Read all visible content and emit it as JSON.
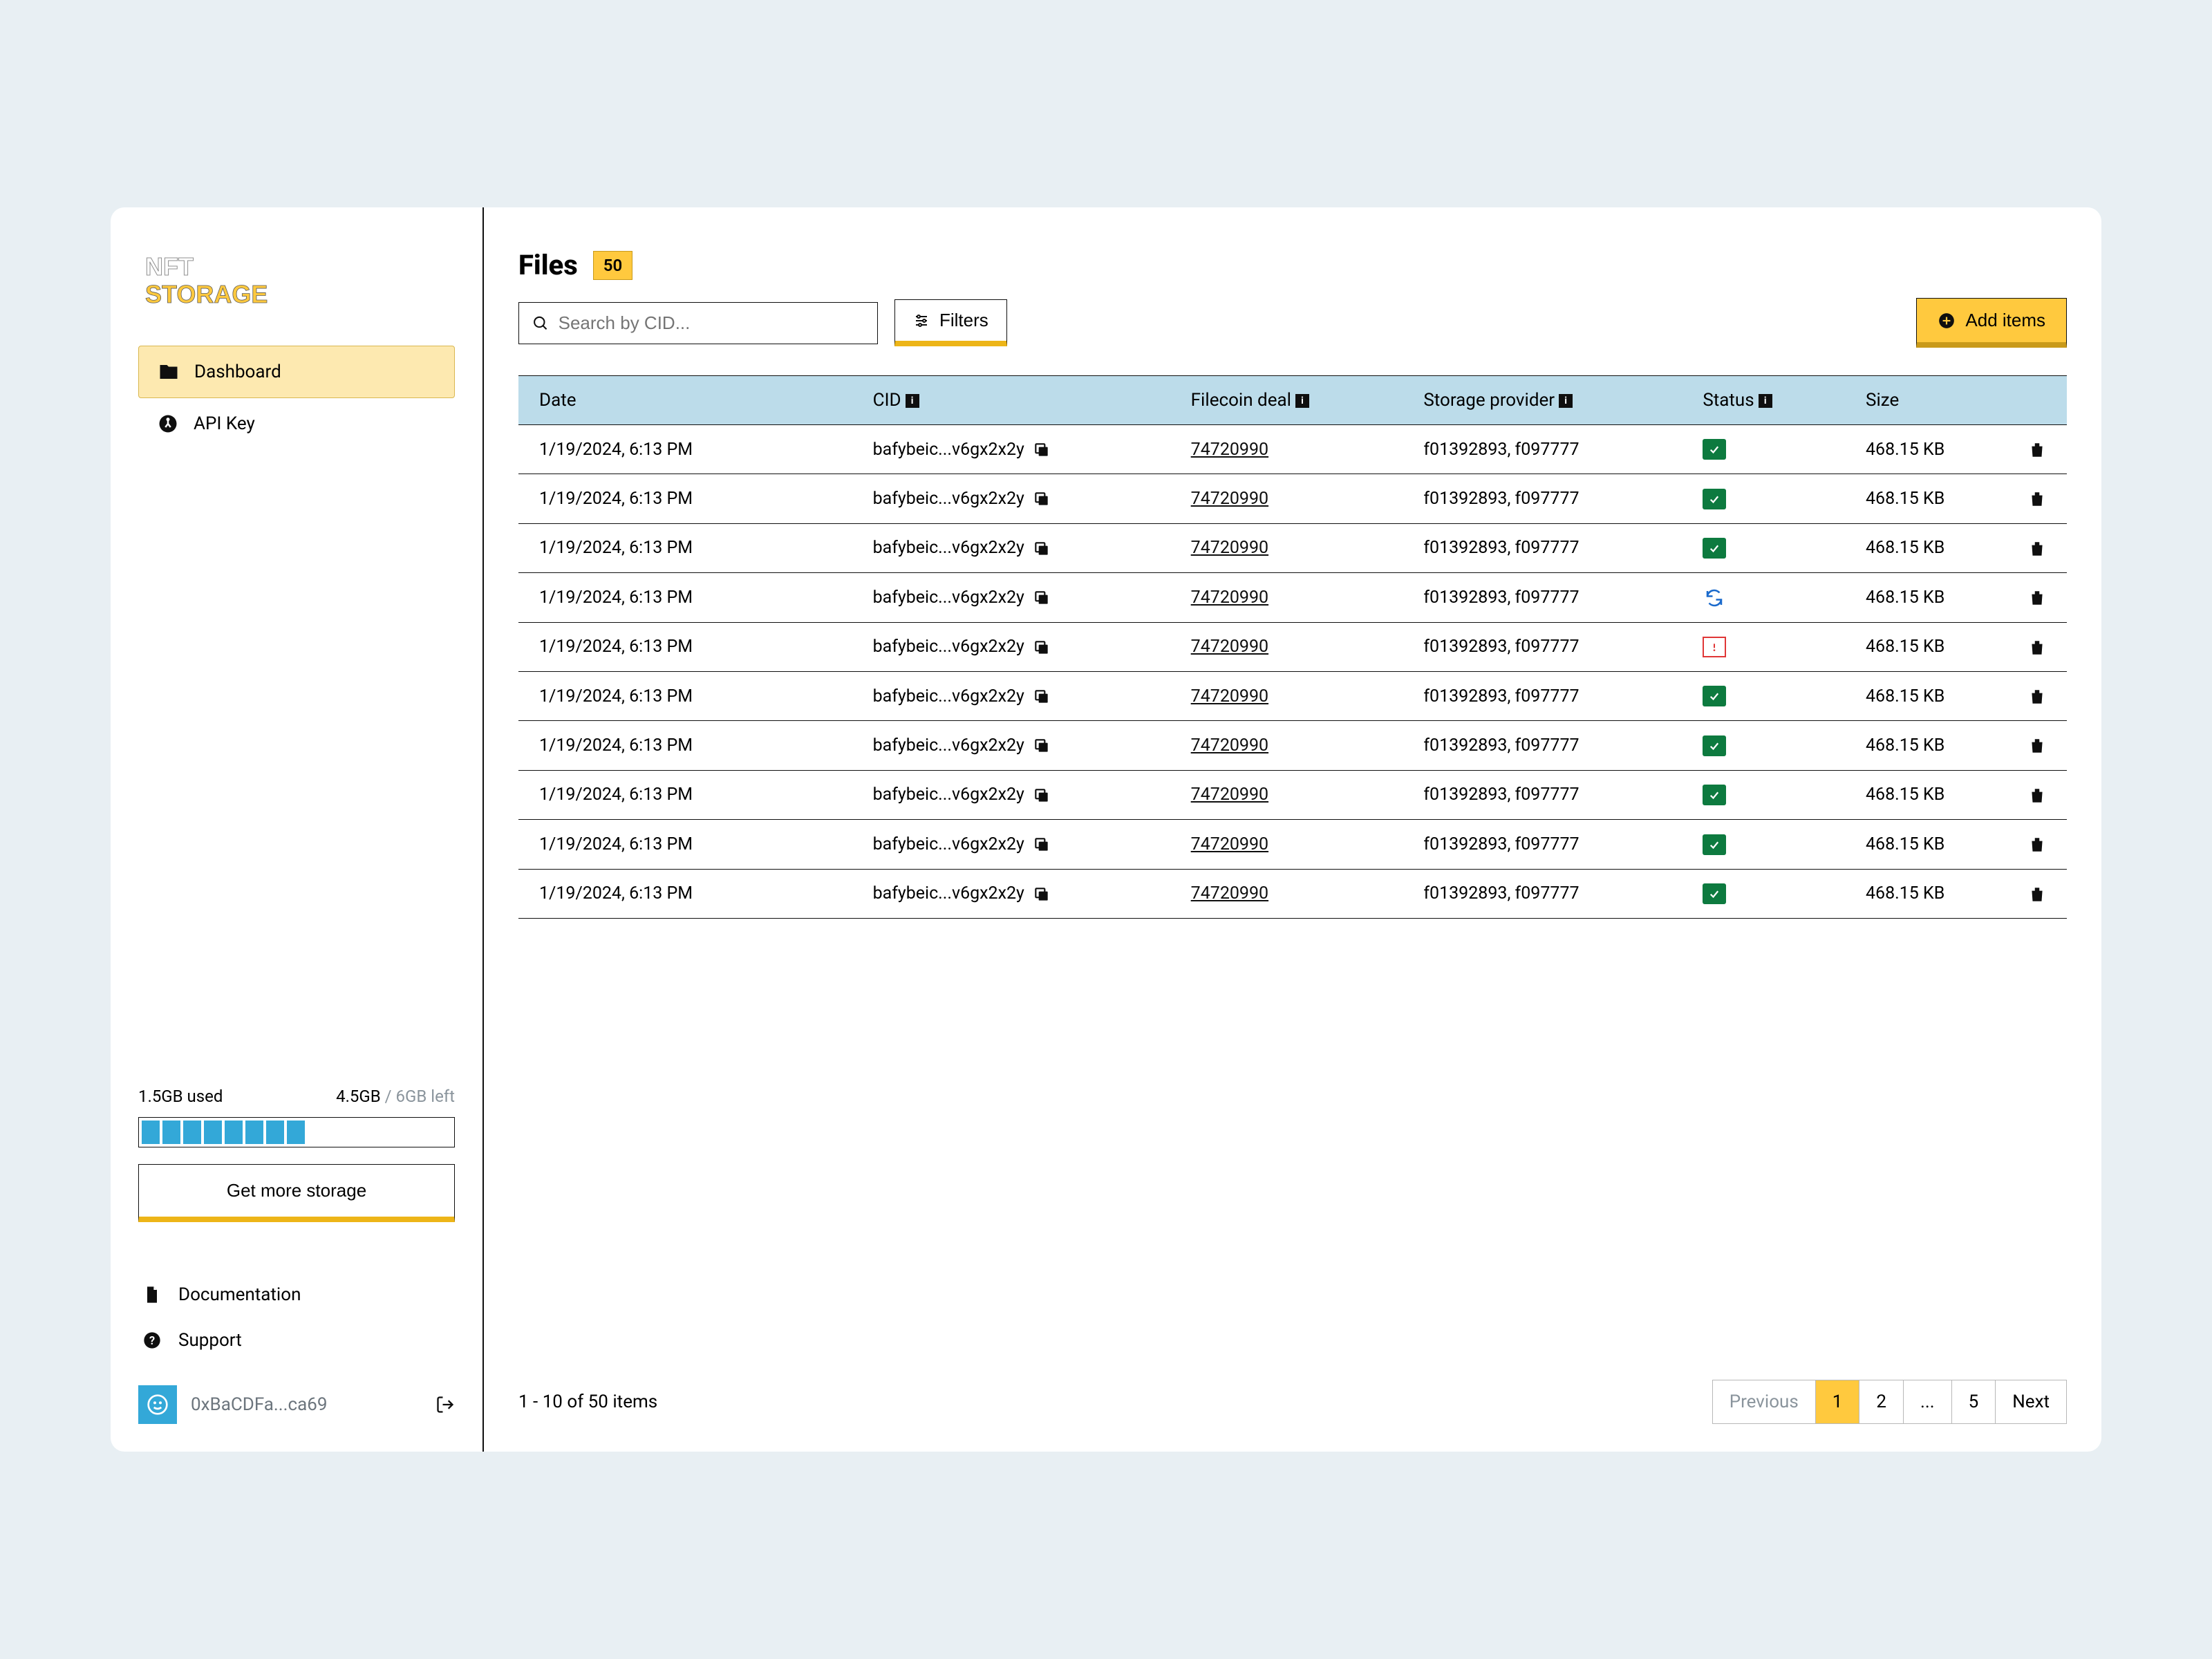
{
  "brand": "NFT STORAGE",
  "sidebar": {
    "items": [
      {
        "label": "Dashboard",
        "icon": "folder-icon",
        "active": true
      },
      {
        "label": "API Key",
        "icon": "key-icon",
        "active": false
      }
    ],
    "storage": {
      "used_label": "1.5GB used",
      "remaining_primary": "4.5GB",
      "remaining_muted": "/ 6GB left",
      "segments_filled": 8,
      "button_label": "Get more storage"
    },
    "footer_links": [
      {
        "label": "Documentation",
        "icon": "doc-icon"
      },
      {
        "label": "Support",
        "icon": "help-icon"
      }
    ],
    "user": {
      "address_short": "0xBaCDFa...ca69"
    }
  },
  "page": {
    "title": "Files",
    "count": "50"
  },
  "toolbar": {
    "search_placeholder": "Search by CID...",
    "filters_label": "Filters",
    "add_label": "Add items"
  },
  "columns": {
    "date": "Date",
    "cid": "CID",
    "deal": "Filecoin deal",
    "provider": "Storage provider",
    "status": "Status",
    "size": "Size"
  },
  "rows": [
    {
      "date": "1/19/2024, 6:13 PM",
      "cid": "bafybeic...v6gx2x2y",
      "deal": "74720990",
      "provider": "f01392893, f097777",
      "status": "ok",
      "size": "468.15 KB"
    },
    {
      "date": "1/19/2024, 6:13 PM",
      "cid": "bafybeic...v6gx2x2y",
      "deal": "74720990",
      "provider": "f01392893, f097777",
      "status": "ok",
      "size": "468.15 KB"
    },
    {
      "date": "1/19/2024, 6:13 PM",
      "cid": "bafybeic...v6gx2x2y",
      "deal": "74720990",
      "provider": "f01392893, f097777",
      "status": "ok",
      "size": "468.15 KB"
    },
    {
      "date": "1/19/2024, 6:13 PM",
      "cid": "bafybeic...v6gx2x2y",
      "deal": "74720990",
      "provider": "f01392893, f097777",
      "status": "sync",
      "size": "468.15 KB"
    },
    {
      "date": "1/19/2024, 6:13 PM",
      "cid": "bafybeic...v6gx2x2y",
      "deal": "74720990",
      "provider": "f01392893, f097777",
      "status": "warn",
      "size": "468.15 KB"
    },
    {
      "date": "1/19/2024, 6:13 PM",
      "cid": "bafybeic...v6gx2x2y",
      "deal": "74720990",
      "provider": "f01392893, f097777",
      "status": "ok",
      "size": "468.15 KB"
    },
    {
      "date": "1/19/2024, 6:13 PM",
      "cid": "bafybeic...v6gx2x2y",
      "deal": "74720990",
      "provider": "f01392893, f097777",
      "status": "ok",
      "size": "468.15 KB"
    },
    {
      "date": "1/19/2024, 6:13 PM",
      "cid": "bafybeic...v6gx2x2y",
      "deal": "74720990",
      "provider": "f01392893, f097777",
      "status": "ok",
      "size": "468.15 KB"
    },
    {
      "date": "1/19/2024, 6:13 PM",
      "cid": "bafybeic...v6gx2x2y",
      "deal": "74720990",
      "provider": "f01392893, f097777",
      "status": "ok",
      "size": "468.15 KB"
    },
    {
      "date": "1/19/2024, 6:13 PM",
      "cid": "bafybeic...v6gx2x2y",
      "deal": "74720990",
      "provider": "f01392893, f097777",
      "status": "ok",
      "size": "468.15 KB"
    }
  ],
  "pagination": {
    "summary": "1 - 10 of 50 items",
    "prev_label": "Previous",
    "next_label": "Next",
    "pages": [
      "1",
      "2",
      "...",
      "5"
    ],
    "active": "1"
  }
}
